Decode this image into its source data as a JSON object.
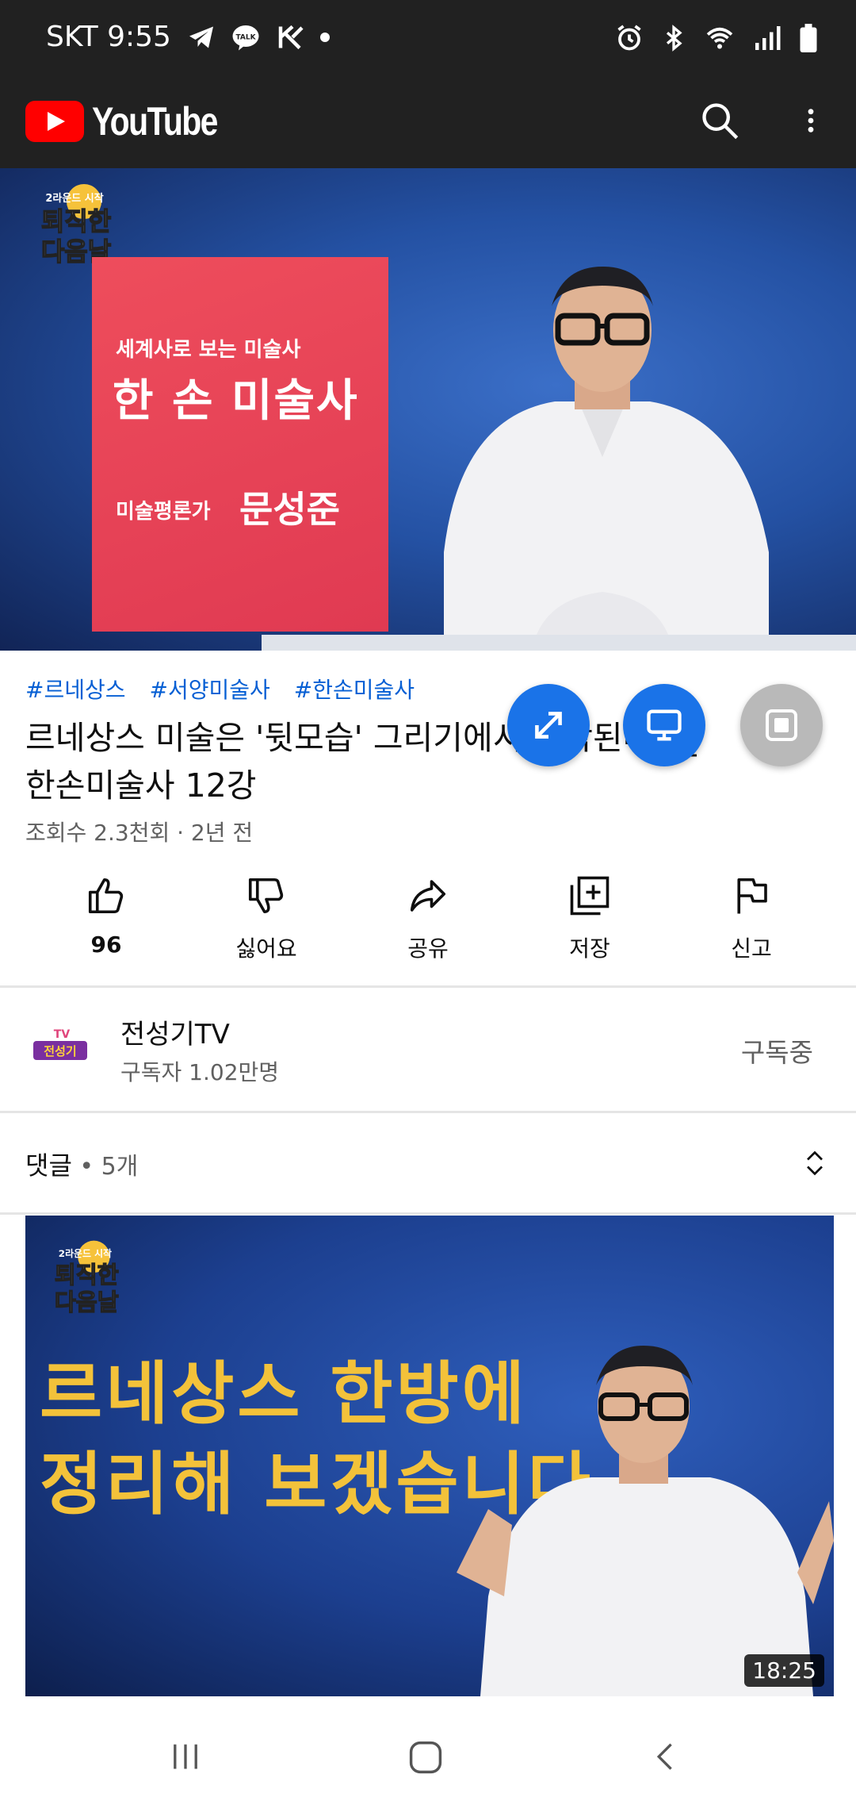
{
  "status_bar": {
    "carrier_time": "SKT 9:55",
    "notification_icons": [
      "telegram-icon",
      "kakaotalk-icon",
      "k-app-icon",
      "dot-icon"
    ],
    "system_icons": [
      "alarm-icon",
      "bluetooth-icon",
      "wifi-icon",
      "signal-icon",
      "battery-icon"
    ]
  },
  "app_bar": {
    "logo_text": "YouTube",
    "brand_color": "#ff0000",
    "icons": [
      "search-icon",
      "more-vert-icon"
    ]
  },
  "video": {
    "show_logo_text": [
      "2라운드 시작",
      "퇴직한",
      "다음날"
    ],
    "card_subtitle": "세계사로 보는 미술사",
    "card_title": "한 손 미술사",
    "card_role": "미술평론가",
    "card_name": "문성준"
  },
  "hashtags": [
    "#르네상스",
    "#서양미술사",
    "#한손미술사"
  ],
  "title_line1": "르네상스 미술은 '뒷모습' 그리기에서 시작된다? _",
  "title_line2": "한손미술사 12강",
  "meta": "조회수 2.3천회 · 2년 전",
  "floating_buttons": [
    "expand-icon",
    "cast-screen-icon",
    "pip-icon"
  ],
  "actions": {
    "like": "96",
    "dislike": "싫어요",
    "share": "공유",
    "save": "저장",
    "report": "신고"
  },
  "channel": {
    "avatar_text": "전성기",
    "avatar_tv": "TV",
    "name": "전성기TV",
    "subscribers": "구독자 1.02만명",
    "subscribe_state": "구독중"
  },
  "comments": {
    "label": "댓글",
    "count": " • 5개"
  },
  "next_video": {
    "logo_text": [
      "2라운드 시작",
      "퇴직한",
      "다음날"
    ],
    "title_line1": "르네상스 한방에",
    "title_line2": "정리해 보겠습니다",
    "duration": "18:25",
    "title_color": "#f3c23a"
  },
  "nav_bar": [
    "recents-icon",
    "home-icon",
    "back-icon"
  ]
}
